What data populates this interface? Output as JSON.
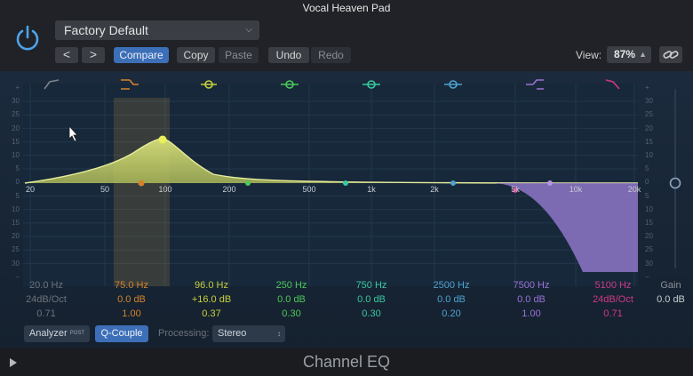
{
  "window": {
    "title": "Vocal Heaven Pad"
  },
  "toolbar": {
    "preset": "Factory Default",
    "prev": "<",
    "next": ">",
    "compare": "Compare",
    "copy": "Copy",
    "paste": "Paste",
    "undo": "Undo",
    "redo": "Redo",
    "view_label": "View:",
    "view_value": "87%"
  },
  "graph": {
    "db_scale_left": [
      "+",
      "30",
      "25",
      "20",
      "15",
      "10",
      "5",
      "0",
      "5",
      "10",
      "15",
      "20",
      "25",
      "30",
      "−"
    ],
    "db_scale_right": [
      "+",
      "30",
      "25",
      "20",
      "15",
      "10",
      "5",
      "0",
      "5",
      "10",
      "15",
      "20",
      "25",
      "30",
      "−"
    ],
    "freq_labels": [
      "20",
      "50",
      "100",
      "200",
      "500",
      "1k",
      "2k",
      "5k",
      "10k",
      "20k"
    ]
  },
  "bands": [
    {
      "freq": "20.0 Hz",
      "gain": "24dB/Oct",
      "q": "0.71",
      "color": "#7d828c"
    },
    {
      "freq": "75.0 Hz",
      "gain": "0.0 dB",
      "q": "1.00",
      "color": "#d5822c"
    },
    {
      "freq": "96.0 Hz",
      "gain": "+16.0 dB",
      "q": "0.37",
      "color": "#c8d03a"
    },
    {
      "freq": "250 Hz",
      "gain": "0.0 dB",
      "q": "0.30",
      "color": "#4cc95a"
    },
    {
      "freq": "750 Hz",
      "gain": "0.0 dB",
      "q": "0.30",
      "color": "#39c9a0"
    },
    {
      "freq": "2500 Hz",
      "gain": "0.0 dB",
      "q": "0.20",
      "color": "#4da3d0"
    },
    {
      "freq": "7500 Hz",
      "gain": "0.0 dB",
      "q": "1.00",
      "color": "#9a72d6"
    },
    {
      "freq": "5100 Hz",
      "gain": "24dB/Oct",
      "q": "0.71",
      "color": "#d0388a"
    }
  ],
  "gain_panel": {
    "label": "Gain",
    "value": "0.0 dB"
  },
  "bottom": {
    "analyzer": "Analyzer",
    "analyzer_tag": "POST",
    "q_couple": "Q-Couple",
    "processing_label": "Processing:",
    "processing_value": "Stereo"
  },
  "plugin_name": "Channel EQ"
}
